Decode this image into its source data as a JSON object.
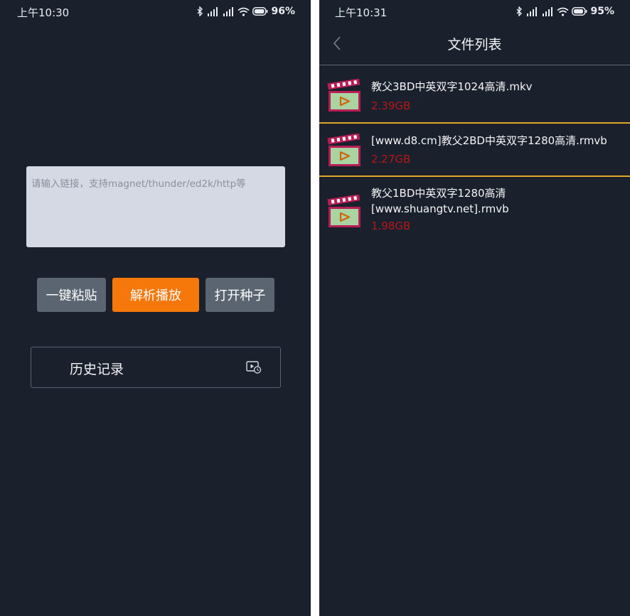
{
  "left_screen": {
    "status": {
      "time": "上午10:30",
      "battery": "96%"
    },
    "input": {
      "placeholder": "请输入链接，支持magnet/thunder/ed2k/http等",
      "value": ""
    },
    "buttons": {
      "paste": "一键粘贴",
      "parse": "解析播放",
      "torrent": "打开种子"
    },
    "history": {
      "label": "历史记录",
      "icon": "play-history-icon"
    }
  },
  "right_screen": {
    "status": {
      "time": "上午10:31",
      "battery": "95%"
    },
    "header": {
      "title": "文件列表",
      "back_icon": "chevron-left-icon"
    },
    "files": [
      {
        "name": "教父3BD中英双字1024高清.mkv",
        "size": "2.39GB",
        "icon": "video-clapper-icon"
      },
      {
        "name": "[www.d8.cm]教父2BD中英双字1280高清.rmvb",
        "size": "2.27GB",
        "icon": "video-clapper-icon"
      },
      {
        "name": "教父1BD中英双字1280高清[www.shuangtv.net].rmvb",
        "size": "1.98GB",
        "icon": "video-clapper-icon"
      }
    ]
  },
  "colors": {
    "background": "#1b212c",
    "accent_orange": "#f6770a",
    "button_grey": "#5b6471",
    "size_red": "#b3171b",
    "separator_gold": "#e0a526"
  }
}
